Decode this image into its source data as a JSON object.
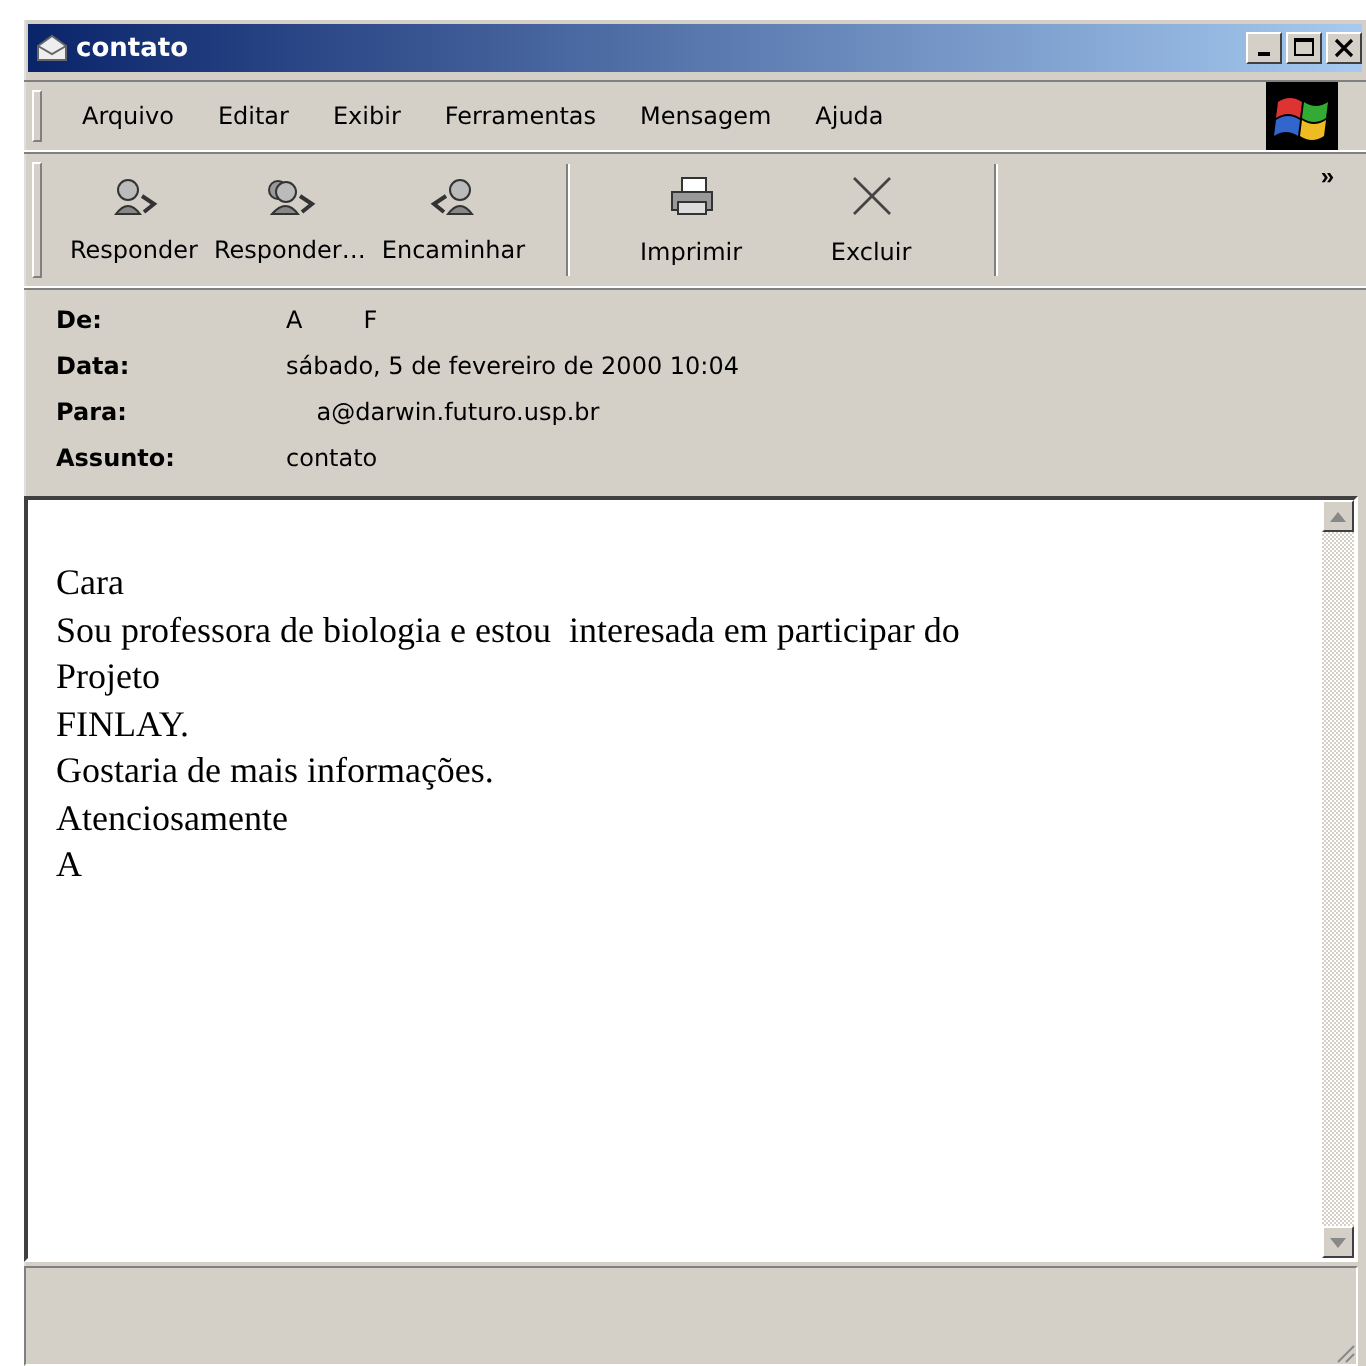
{
  "window": {
    "title": "contato"
  },
  "menu": [
    "Arquivo",
    "Editar",
    "Exibir",
    "Ferramentas",
    "Mensagem",
    "Ajuda"
  ],
  "toolbar": [
    {
      "label": "Responder",
      "kind": "reply"
    },
    {
      "label": "Responder…",
      "kind": "reply-all"
    },
    {
      "label": "Encaminhar",
      "kind": "forward"
    },
    {
      "label": "Imprimir",
      "kind": "print"
    },
    {
      "label": "Excluir",
      "kind": "delete"
    }
  ],
  "toolbar_more": "»",
  "headers": [
    {
      "label": "De:",
      "value": "A        F"
    },
    {
      "label": "Data:",
      "value": "sábado, 5 de fevereiro de 2000 10:04"
    },
    {
      "label": "Para:",
      "value": "    a@darwin.futuro.usp.br"
    },
    {
      "label": "Assunto:",
      "value": "contato"
    }
  ],
  "body": [
    "Cara",
    "Sou professora de biologia e estou  interesada em participar do",
    "Projeto",
    "FINLAY.",
    "Gostaria de mais informações.",
    "Atenciosamente",
    "A"
  ]
}
